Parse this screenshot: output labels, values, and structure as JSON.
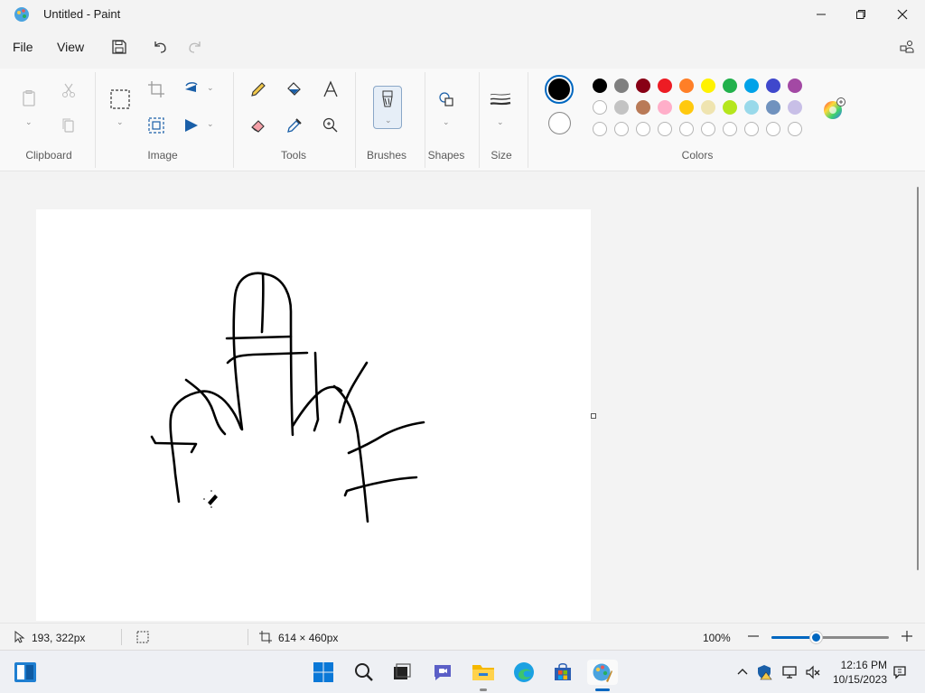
{
  "window": {
    "title": "Untitled - Paint",
    "minimize_icon": "minimize-icon",
    "maximize_icon": "restore-icon",
    "close_icon": "close-icon"
  },
  "menu": {
    "file": "File",
    "view": "View"
  },
  "ribbon": {
    "groups": {
      "clipboard": "Clipboard",
      "image": "Image",
      "tools": "Tools",
      "brushes": "Brushes",
      "shapes": "Shapes",
      "size": "Size",
      "colors": "Colors"
    },
    "primary_color": "#000000",
    "secondary_color": "#ffffff",
    "palette": [
      "#000000",
      "#7f7f7f",
      "#880015",
      "#ed1c24",
      "#ff7f27",
      "#fff200",
      "#22b14c",
      "#00a2e8",
      "#3f48cc",
      "#a349a4",
      "#ffffff",
      "#c3c3c3",
      "#b97a57",
      "#ffaec9",
      "#ffc90e",
      "#efe4b0",
      "#b5e61d",
      "#99d9ea",
      "#7092be",
      "#c8bfe7"
    ]
  },
  "status": {
    "cursor_position": "193, 322px",
    "canvas_size": "614 × 460px",
    "zoom": "100%",
    "zoom_fraction": 0.38
  },
  "taskbar": {
    "time": "12:16 PM",
    "date": "10/15/2023"
  },
  "colors": {
    "accent": "#0067c0",
    "ribbon_bg": "#f9f9f9",
    "workspace_bg": "#f3f3f3"
  }
}
